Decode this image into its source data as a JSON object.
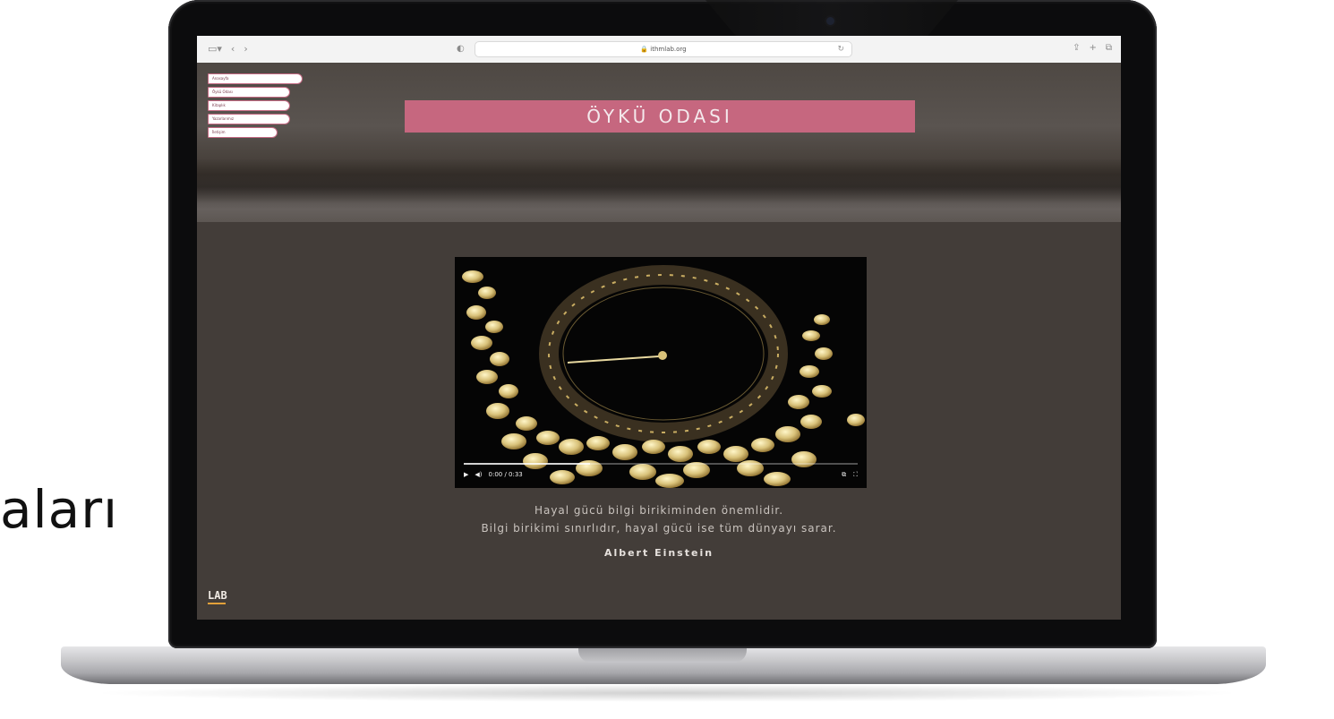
{
  "caption_fragment": "aları",
  "browser": {
    "left_icons": [
      "sidebar-icon",
      "chevron-left-icon",
      "chevron-right-icon"
    ],
    "url": "🔒 ithmlab.org",
    "right_icons": [
      "share-icon",
      "new-tab-icon",
      "tabs-icon"
    ]
  },
  "page": {
    "nav_items": [
      "Anasayfa",
      "Öykü Odası",
      "Kitaplık",
      "Yazarlarımız",
      "İletişim"
    ],
    "title": "ÖYKÜ ODASI",
    "video": {
      "time": "0:00 / 0:33",
      "progress": 0.32
    },
    "quote_line1": "Hayal gücü bilgi birikiminden önemlidir.",
    "quote_line2": "Bilgi birikimi sınırlıdır, hayal gücü ise tüm dünyayı sarar.",
    "author": "Albert Einstein",
    "logo": "LAB"
  },
  "colors": {
    "title_bar": "#c6677f",
    "page_bg": "#433d39",
    "nav_border": "#c46a83",
    "logo_accent": "#e3a13a"
  }
}
